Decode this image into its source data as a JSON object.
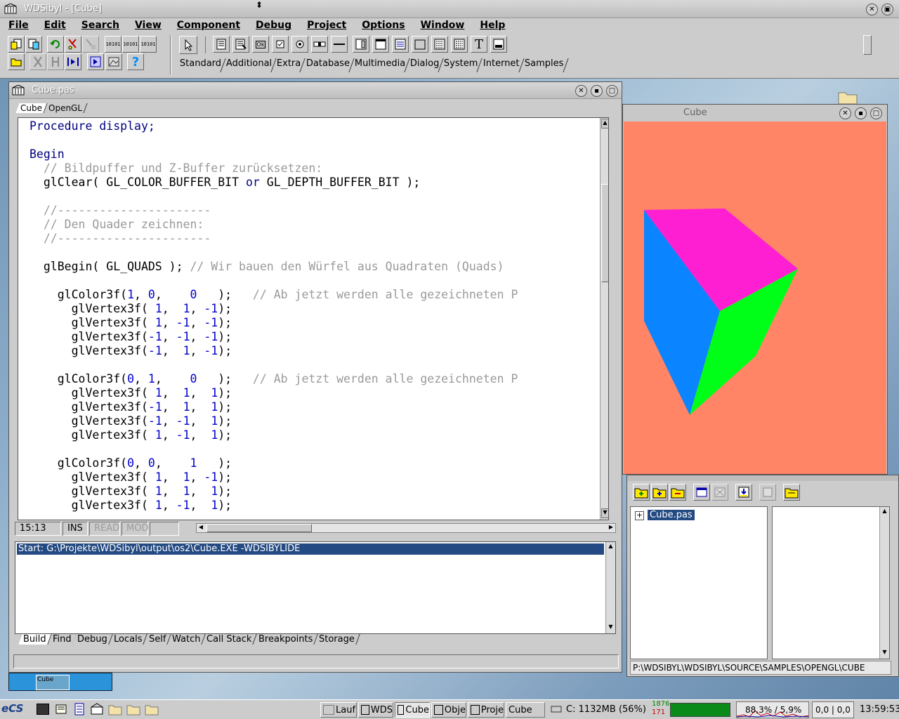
{
  "app": {
    "title": "WDSibyl - [Cube]"
  },
  "menu": [
    "File",
    "Edit",
    "Search",
    "View",
    "Component",
    "Debug",
    "Project",
    "Options",
    "Window",
    "Help"
  ],
  "palette_tabs": [
    "Standard",
    "Additional",
    "Extra",
    "Database",
    "Multimedia",
    "Dialog",
    "System",
    "Internet",
    "Samples"
  ],
  "toolbar": {
    "ok_label": "Ok",
    "text_label": "T"
  },
  "editor": {
    "title": "Cube.pas",
    "tabs": [
      "Cube",
      "OpenGL"
    ],
    "code": [
      [
        [
          "kw",
          "Procedure display;"
        ]
      ],
      [],
      [
        [
          "kw",
          "Begin"
        ]
      ],
      [
        [
          "cm",
          "  // Bildpuffer und Z-Buffer zurücksetzen:"
        ]
      ],
      [
        [
          "",
          "  glClear( GL_COLOR_BUFFER_BIT "
        ],
        [
          "kw",
          "or"
        ],
        [
          "",
          " GL_DEPTH_BUFFER_BIT );"
        ]
      ],
      [],
      [
        [
          "cm",
          "  //----------------------"
        ]
      ],
      [
        [
          "cm",
          "  // Den Quader zeichnen:"
        ]
      ],
      [
        [
          "cm",
          "  //----------------------"
        ]
      ],
      [],
      [
        [
          "",
          "  glBegin( GL_QUADS ); "
        ],
        [
          "cm",
          "// Wir bauen den Würfel aus Quadraten (Quads)"
        ]
      ],
      [],
      [
        [
          "",
          "    glColor3f("
        ],
        [
          "nu",
          "1"
        ],
        [
          "",
          ", "
        ],
        [
          "nu",
          "0"
        ],
        [
          "",
          ",    "
        ],
        [
          "nu",
          "0"
        ],
        [
          "",
          "   );   "
        ],
        [
          "cm",
          "// Ab jetzt werden alle gezeichneten P"
        ]
      ],
      [
        [
          "",
          "      glVertex3f( "
        ],
        [
          "nu",
          "1"
        ],
        [
          "",
          ",  "
        ],
        [
          "nu",
          "1"
        ],
        [
          "",
          ", "
        ],
        [
          "nu",
          "-1"
        ],
        [
          "",
          ");"
        ]
      ],
      [
        [
          "",
          "      glVertex3f( "
        ],
        [
          "nu",
          "1"
        ],
        [
          "",
          ", "
        ],
        [
          "nu",
          "-1"
        ],
        [
          "",
          ", "
        ],
        [
          "nu",
          "-1"
        ],
        [
          "",
          ");"
        ]
      ],
      [
        [
          "",
          "      glVertex3f("
        ],
        [
          "nu",
          "-1"
        ],
        [
          "",
          ", "
        ],
        [
          "nu",
          "-1"
        ],
        [
          "",
          ", "
        ],
        [
          "nu",
          "-1"
        ],
        [
          "",
          ");"
        ]
      ],
      [
        [
          "",
          "      glVertex3f("
        ],
        [
          "nu",
          "-1"
        ],
        [
          "",
          ",  "
        ],
        [
          "nu",
          "1"
        ],
        [
          "",
          ", "
        ],
        [
          "nu",
          "-1"
        ],
        [
          "",
          ");"
        ]
      ],
      [],
      [
        [
          "",
          "    glColor3f("
        ],
        [
          "nu",
          "0"
        ],
        [
          "",
          ", "
        ],
        [
          "nu",
          "1"
        ],
        [
          "",
          ",    "
        ],
        [
          "nu",
          "0"
        ],
        [
          "",
          "   );   "
        ],
        [
          "cm",
          "// Ab jetzt werden alle gezeichneten P"
        ]
      ],
      [
        [
          "",
          "      glVertex3f( "
        ],
        [
          "nu",
          "1"
        ],
        [
          "",
          ",  "
        ],
        [
          "nu",
          "1"
        ],
        [
          "",
          ",  "
        ],
        [
          "nu",
          "1"
        ],
        [
          "",
          ");"
        ]
      ],
      [
        [
          "",
          "      glVertex3f("
        ],
        [
          "nu",
          "-1"
        ],
        [
          "",
          ",  "
        ],
        [
          "nu",
          "1"
        ],
        [
          "",
          ",  "
        ],
        [
          "nu",
          "1"
        ],
        [
          "",
          ");"
        ]
      ],
      [
        [
          "",
          "      glVertex3f("
        ],
        [
          "nu",
          "-1"
        ],
        [
          "",
          ", "
        ],
        [
          "nu",
          "-1"
        ],
        [
          "",
          ",  "
        ],
        [
          "nu",
          "1"
        ],
        [
          "",
          ");"
        ]
      ],
      [
        [
          "",
          "      glVertex3f( "
        ],
        [
          "nu",
          "1"
        ],
        [
          "",
          ", "
        ],
        [
          "nu",
          "-1"
        ],
        [
          "",
          ",  "
        ],
        [
          "nu",
          "1"
        ],
        [
          "",
          ");"
        ]
      ],
      [],
      [
        [
          "",
          "    glColor3f("
        ],
        [
          "nu",
          "0"
        ],
        [
          "",
          ", "
        ],
        [
          "nu",
          "0"
        ],
        [
          "",
          ",    "
        ],
        [
          "nu",
          "1"
        ],
        [
          "",
          "   );"
        ]
      ],
      [
        [
          "",
          "      glVertex3f( "
        ],
        [
          "nu",
          "1"
        ],
        [
          "",
          ",  "
        ],
        [
          "nu",
          "1"
        ],
        [
          "",
          ", "
        ],
        [
          "nu",
          "-1"
        ],
        [
          "",
          ");"
        ]
      ],
      [
        [
          "",
          "      glVertex3f( "
        ],
        [
          "nu",
          "1"
        ],
        [
          "",
          ",  "
        ],
        [
          "nu",
          "1"
        ],
        [
          "",
          ",  "
        ],
        [
          "nu",
          "1"
        ],
        [
          "",
          ");"
        ]
      ],
      [
        [
          "",
          "      glVertex3f( "
        ],
        [
          "nu",
          "1"
        ],
        [
          "",
          ", "
        ],
        [
          "nu",
          "-1"
        ],
        [
          "",
          ",  "
        ],
        [
          "nu",
          "1"
        ],
        [
          "",
          ");"
        ]
      ]
    ],
    "status": {
      "position": "15:13",
      "ins": "INS",
      "read": "READ",
      "mod": "MOD"
    }
  },
  "messages": {
    "lines": [
      "Start: G:\\Projekte\\WDSibyl\\output\\os2\\Cube.EXE -WDSIBYLIDE"
    ],
    "tabs": [
      "Build",
      "Find",
      "Debug",
      "Locals",
      "Self",
      "Watch",
      "Call Stack",
      "Breakpoints",
      "Storage"
    ]
  },
  "cube_window": {
    "title": "Cube",
    "background": "#ff8566",
    "face_colors": [
      "#ff1fd2",
      "#0a84ff",
      "#00ff18"
    ]
  },
  "project_manager": {
    "file": "Cube.pas",
    "path": "P:\\WDSIBYL\\WDSIBYL\\SOURCE\\SAMPLES\\OPENGL\\CUBE"
  },
  "minimized": {
    "label": "Cube"
  },
  "taskbar": {
    "tasks": [
      "Lauf",
      "WDS",
      "Cube",
      "Obje",
      "Proje",
      "Cube"
    ],
    "drive": "C: 1132MB (56%)",
    "mem_top": "1876",
    "mem_bottom": "171",
    "cpu": "88,3% / 5,9%",
    "net": "0,0 | 0,0",
    "clock": "13:59:53"
  }
}
